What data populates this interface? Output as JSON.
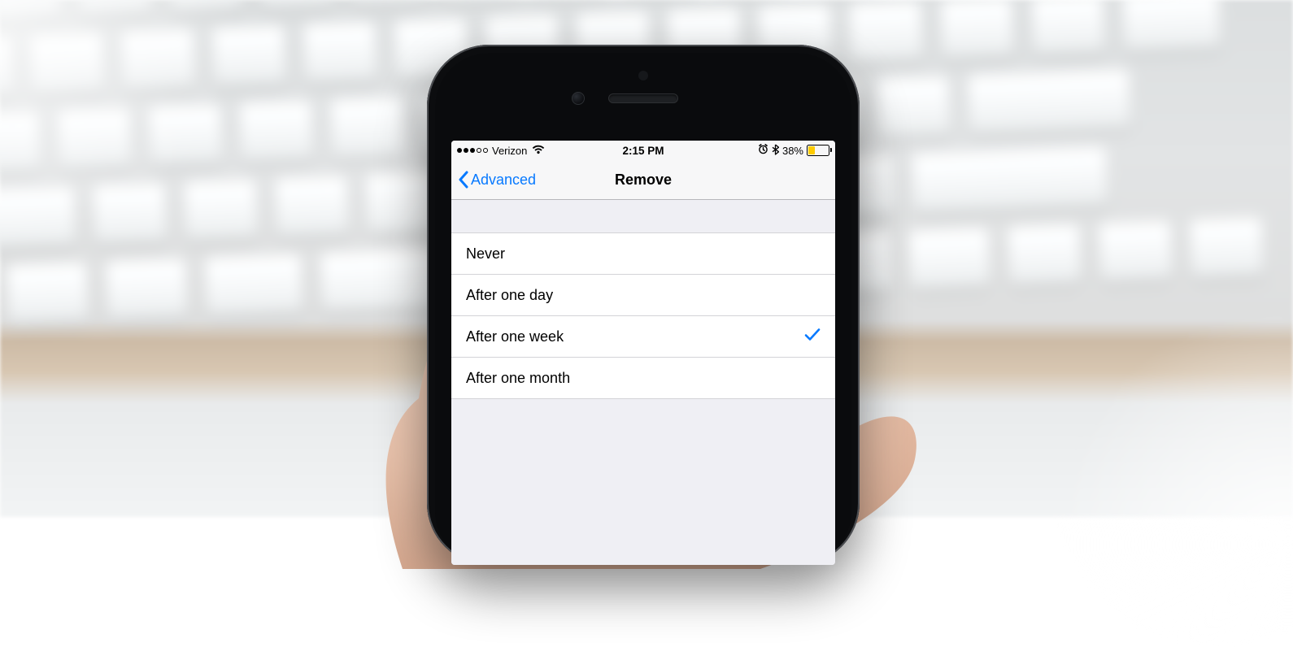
{
  "statusbar": {
    "signal_dots_filled": 3,
    "signal_dots_total": 5,
    "carrier": "Verizon",
    "time": "2:15 PM",
    "battery_percent_label": "38%",
    "battery_percent": 38,
    "battery_fill_color": "#ffcc00",
    "alarm_visible": true,
    "bluetooth_visible": true,
    "wifi_visible": true
  },
  "navbar": {
    "back_label": "Advanced",
    "title": "Remove"
  },
  "options": [
    {
      "label": "Never",
      "selected": false
    },
    {
      "label": "After one day",
      "selected": false
    },
    {
      "label": "After one week",
      "selected": true
    },
    {
      "label": "After one month",
      "selected": false
    }
  ],
  "colors": {
    "ios_tint": "#0779ff",
    "bg_grouped": "#efeff4",
    "separator": "#d3d3d7"
  }
}
